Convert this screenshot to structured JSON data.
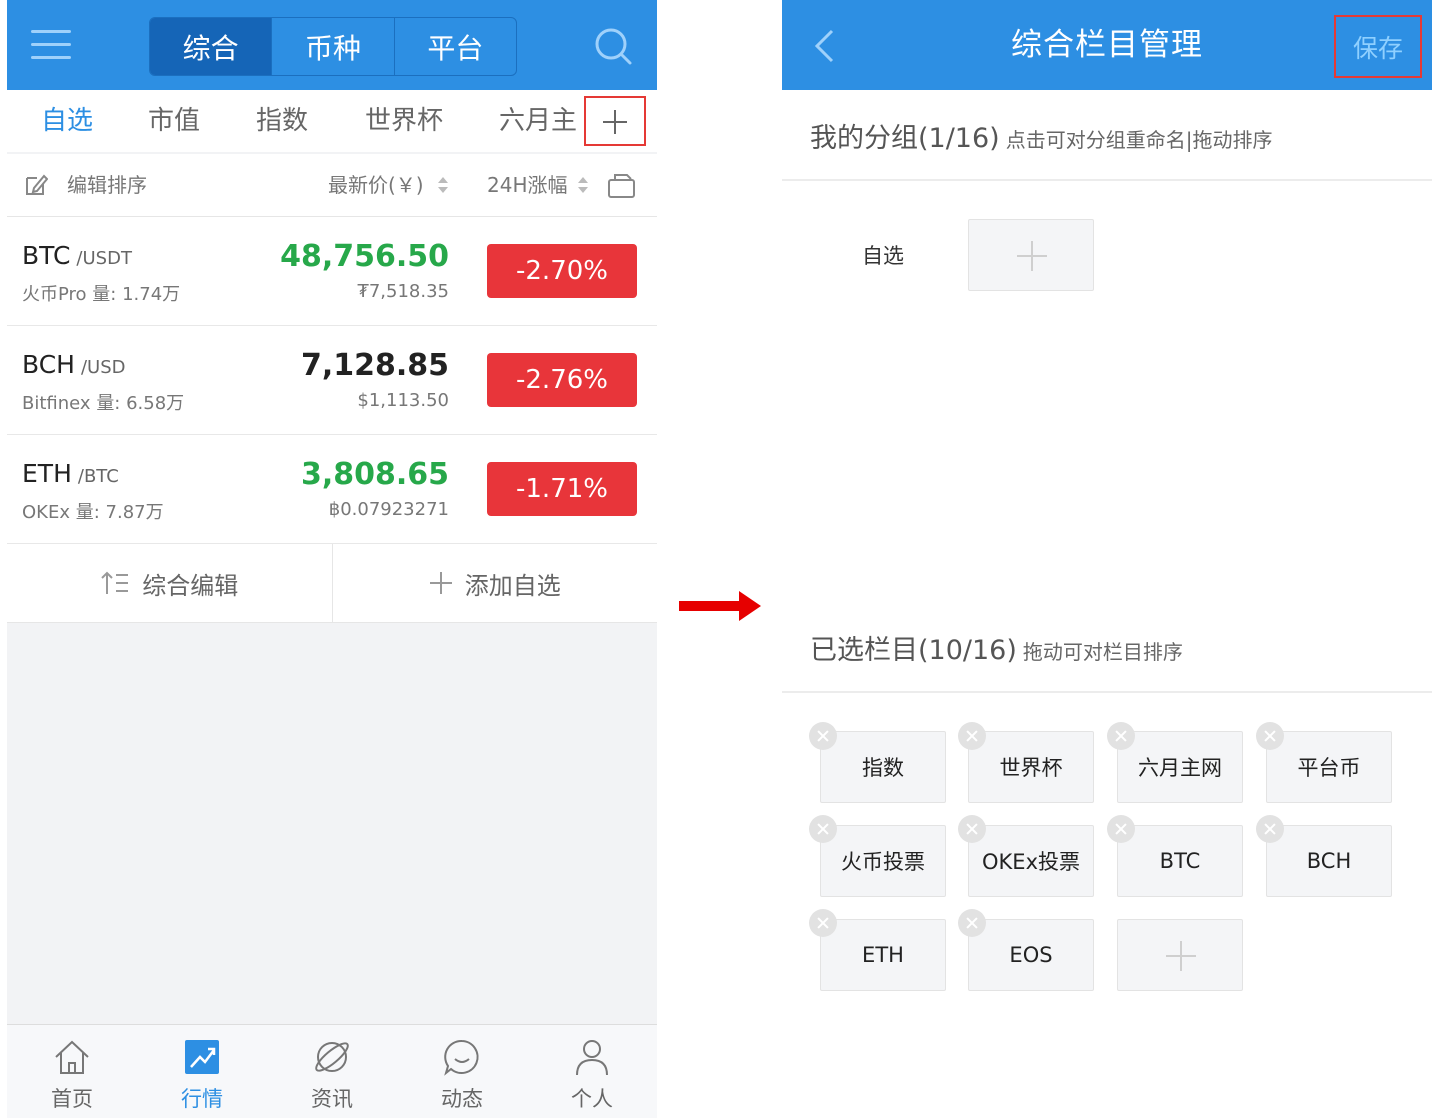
{
  "left": {
    "segments": [
      "综合",
      "币种",
      "平台"
    ],
    "subtabs": [
      "自选",
      "市值",
      "指数",
      "世界杯",
      "六月主"
    ],
    "header": {
      "edit_sort": "编辑排序",
      "price_col": "最新价(￥)",
      "change_col": "24H涨幅"
    },
    "rows": [
      {
        "symbol": "BTC",
        "pair": "/USDT",
        "exchange": "火币Pro",
        "volume": "量: 1.74万",
        "price": "48,756.50",
        "alt_price": "₮7,518.35",
        "change": "-2.70%",
        "price_color": "#27a84a"
      },
      {
        "symbol": "BCH",
        "pair": "/USD",
        "exchange": "Bitfinex",
        "volume": "量: 6.58万",
        "price": "7,128.85",
        "alt_price": "$1,113.50",
        "change": "-2.76%",
        "price_color": "#222222"
      },
      {
        "symbol": "ETH",
        "pair": "/BTC",
        "exchange": "OKEx",
        "volume": "量: 7.87万",
        "price": "3,808.65",
        "alt_price": "฿0.07923271",
        "change": "-1.71%",
        "price_color": "#27a84a"
      }
    ],
    "actions": {
      "edit": "综合编辑",
      "add": "添加自选"
    },
    "tabbar": [
      "首页",
      "行情",
      "资讯",
      "动态",
      "个人"
    ]
  },
  "right": {
    "title": "综合栏目管理",
    "save": "保存",
    "groups_title": "我的分组(1/16)",
    "groups_hint": "点击可对分组重命名|拖动排序",
    "group_items": [
      "自选"
    ],
    "selected_title": "已选栏目(10/16)",
    "selected_hint": "拖动可对栏目排序",
    "selected_items": [
      "指数",
      "世界杯",
      "六月主网",
      "平台币",
      "火币投票",
      "OKEx投票",
      "BTC",
      "BCH",
      "ETH",
      "EOS"
    ]
  },
  "colors": {
    "brand": "#2d8fe3",
    "down": "#e8353a",
    "up": "#27a84a",
    "highlight": "#e53935"
  }
}
